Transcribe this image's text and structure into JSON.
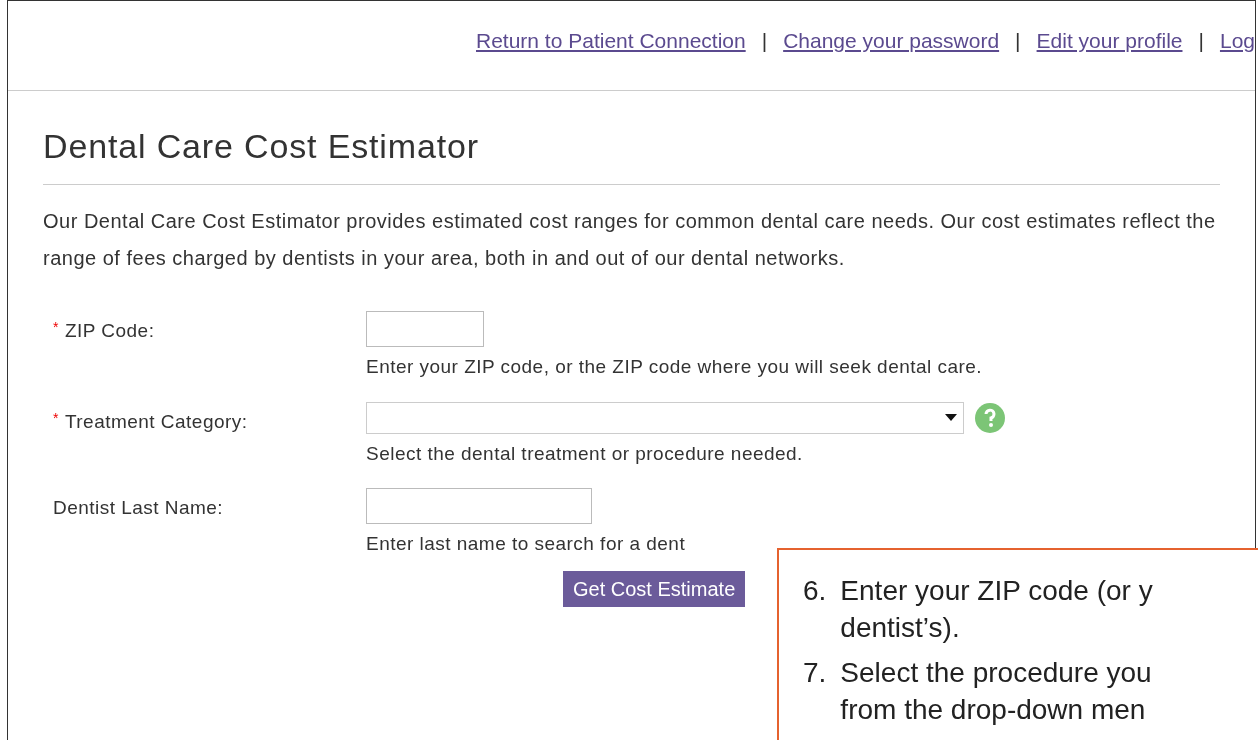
{
  "nav": [
    {
      "kind": "link",
      "text": "Return to Patient Connection"
    },
    {
      "kind": "separator",
      "text": "|"
    },
    {
      "kind": "link",
      "text": "Change your password"
    },
    {
      "kind": "separator",
      "text": "|"
    },
    {
      "kind": "link",
      "text": "Edit your profile"
    },
    {
      "kind": "separator",
      "text": "|"
    },
    {
      "kind": "link",
      "text": "Log"
    }
  ],
  "title": "Dental Care Cost Estimator",
  "intro": "Our Dental Care Cost Estimator provides estimated cost ranges for common dental care needs. Our cost estimates reflect the range of fees charged by dentists in your area, both in and out of our dental networks.",
  "fields": [
    {
      "kind": "short_text",
      "required": true,
      "required_mark": "*",
      "label": "ZIP Code:",
      "hint": "Enter your ZIP code, or the ZIP code where you will seek dental care.",
      "help": false
    },
    {
      "kind": "select",
      "required": true,
      "required_mark": "*",
      "label": "Treatment Category:",
      "hint": "Select the dental treatment or procedure needed.",
      "help": true
    },
    {
      "kind": "text",
      "required": false,
      "label": "Dentist Last Name:",
      "hint": "Enter last name to search for a dent",
      "help": false
    }
  ],
  "submit": "Get Cost Estimate",
  "callout": {
    "steps": [
      {
        "number": "6.",
        "lines": [
          "Enter your ZIP code (or y",
          "dentist’s)."
        ]
      },
      {
        "number": "7.",
        "lines": [
          "Select the procedure you",
          "from the drop-down men"
        ]
      }
    ]
  }
}
